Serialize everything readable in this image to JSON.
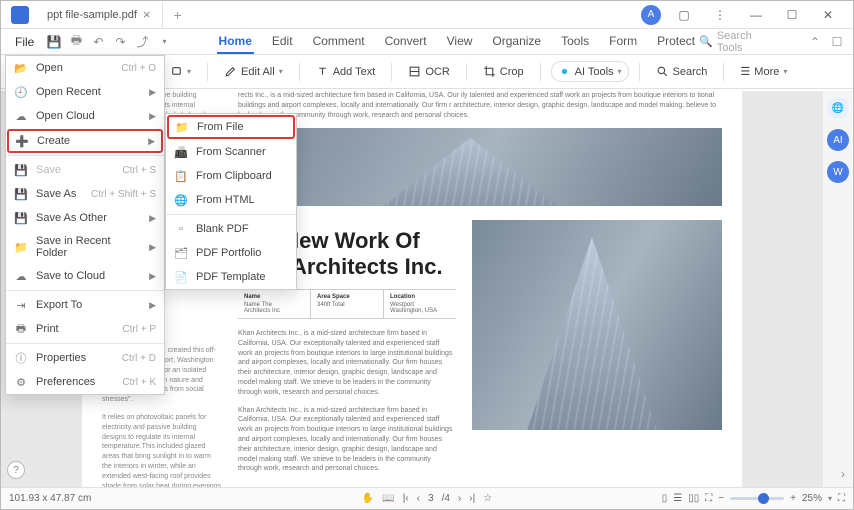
{
  "titlebar": {
    "filename": "ppt file-sample.pdf",
    "user_initial": "A"
  },
  "menubar": {
    "file": "File"
  },
  "tabs": [
    "Home",
    "Edit",
    "Comment",
    "Convert",
    "View",
    "Organize",
    "Tools",
    "Form",
    "Protect"
  ],
  "search_placeholder": "Search Tools",
  "ribbon": {
    "edit_all": "Edit All",
    "add_text": "Add Text",
    "ocr": "OCR",
    "crop": "Crop",
    "ai_tools": "AI Tools",
    "search": "Search",
    "more": "More"
  },
  "file_menu": [
    {
      "label": "Open",
      "shortcut": "Ctrl + O",
      "icon": "open"
    },
    {
      "label": "Open Recent",
      "arrow": true,
      "icon": "recent"
    },
    {
      "label": "Open Cloud",
      "arrow": true,
      "icon": "cloud"
    },
    {
      "label": "Create",
      "arrow": true,
      "icon": "create",
      "highlight": true
    },
    {
      "label": "Save",
      "shortcut": "Ctrl + S",
      "icon": "save",
      "disabled": true,
      "sep_before": true
    },
    {
      "label": "Save As",
      "shortcut": "Ctrl + Shift + S",
      "icon": "saveas"
    },
    {
      "label": "Save As Other",
      "arrow": true,
      "icon": "saveother"
    },
    {
      "label": "Save in Recent Folder",
      "arrow": true,
      "icon": "savefolder"
    },
    {
      "label": "Save to Cloud",
      "arrow": true,
      "icon": "savecloud"
    },
    {
      "label": "Export To",
      "arrow": true,
      "icon": "export",
      "sep_before": true
    },
    {
      "label": "Print",
      "shortcut": "Ctrl + P",
      "icon": "print"
    },
    {
      "label": "Properties",
      "shortcut": "Ctrl + D",
      "icon": "props",
      "sep_before": true
    },
    {
      "label": "Preferences",
      "shortcut": "Ctrl + K",
      "icon": "prefs"
    }
  ],
  "create_submenu": [
    {
      "label": "From File",
      "icon": "folder",
      "highlight": true
    },
    {
      "label": "From Scanner",
      "icon": "scanner"
    },
    {
      "label": "From Clipboard",
      "icon": "clipboard"
    },
    {
      "label": "From HTML",
      "icon": "html"
    },
    {
      "label": "Blank PDF",
      "icon": "blank",
      "sep_before": true
    },
    {
      "label": "PDF Portfolio",
      "icon": "portfolio"
    },
    {
      "label": "PDF Template",
      "icon": "template"
    }
  ],
  "document": {
    "col_para1": "electricity and passive building designs to regulate its internal temperature.This included glazed areas that bring",
    "hero_para": "rects Inc., is a mid-sized architecture firm based in California, USA. Our ily talented and experienced staff work an projects from boutique interiors to tional buildings and airport complexes, locally and internationally. Our firm r architecture, interior design, graphic design, landscape and model making. believe to be leaders in the community through work, research and personal choices.",
    "title": "The New Work Of Klan Architects Inc.",
    "table": {
      "c1": {
        "label": "Name",
        "v1": "Name The",
        "v2": "Architects Inc"
      },
      "c2": {
        "label": "Area Space",
        "v1": "340ft Total",
        "v2": ""
      },
      "c3": {
        "label": "Location",
        "v1": "Westport",
        "v2": "Washington, USA"
      }
    },
    "left_block1": "Khan Architects Inc., created this off-grid retreat in Westport, Washington for a family looking for an isolated place to connect with nature and \"distance themselves from social stresses\".",
    "left_block2": "It relies on photovoltaic panels for electricity and passive building designs to regulate its internal temperature.This included glazed areas that bring sunlight in to warm the interiors in winter, while an extended west-facing roof provides shade from solar heat during evenings in the summer.",
    "para1": "Khan Architects Inc., is a mid-sized architecture firm based in California, USA. Our exceptionally talented and experienced staff work an projects from boutique interiors to large institutional buildings and airport complexes, locally and internationally. Our firm houses their architecture, interior design, graphic design, landscape and model making staff. We strieve to be leaders in the community through work, research and personal choices.",
    "para2": "Khan Architects Inc., is a mid-sized architecture firm based in California, USA. Our exceptionally talented and experienced staff work an projects from boutique interiors to large institutional buildings and airport complexes, locally and internationally. Our firm houses their architecture, interior design, graphic design, landscape and model making staff. We strieve to be leaders in the community through work, research and personal choices."
  },
  "statusbar": {
    "dims": "101.93 x 47.87 cm",
    "page": "3",
    "total": "4",
    "zoom": "25%"
  }
}
